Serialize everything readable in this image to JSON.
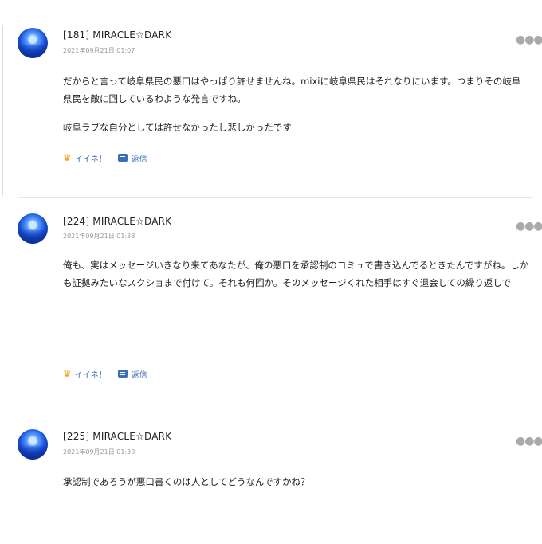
{
  "comments": [
    {
      "author": "[181] MIRACLE☆DARK",
      "timestamp": "2021年09月21日 01:07",
      "paragraphs": [
        "だからと言って岐阜県民の悪口はやっぱり許せませんね。mixiに岐阜県民はそれなりにいます。つまりその岐阜県民を敵に回しているわような発言ですね。",
        "岐阜ラブな自分としては許せなかったし悲しかったです"
      ],
      "like_label": "イイネ！",
      "reply_label": "返信"
    },
    {
      "author": "[224] MIRACLE☆DARK",
      "timestamp": "2021年09月21日 01:38",
      "paragraphs": [
        "俺も、実はメッセージいきなり来てあなたが、俺の悪口を承認制のコミュで書き込んでるときたんですがね。しかも証拠みたいなスクショまで付けて。それも何回か。そのメッセージくれた相手はすぐ退会しての繰り返しで"
      ],
      "like_label": "イイネ！",
      "reply_label": "返信"
    },
    {
      "author": "[225] MIRACLE☆DARK",
      "timestamp": "2021年09月21日 01:39",
      "paragraphs": [
        "承認制であろうが悪口書くのは人としてどうなんですかね？"
      ]
    }
  ],
  "icons": {
    "more": "more-dots-icon",
    "like": "like-icon",
    "reply": "reply-icon",
    "avatar": "avatar-moon-image"
  },
  "colors": {
    "accent": "#3a6fb6",
    "like": "#f3a21a",
    "meta": "#999999"
  }
}
